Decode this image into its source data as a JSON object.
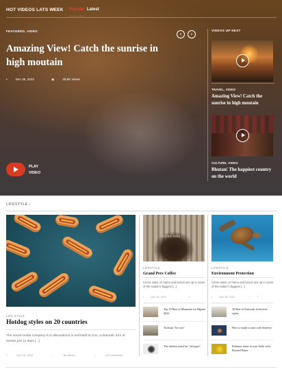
{
  "header": {
    "hot_label": "HOT VIDEOS LATS WEEK",
    "tabs": [
      {
        "label": "Popular",
        "active": true
      },
      {
        "label": "Latest",
        "active": false
      }
    ]
  },
  "hero": {
    "category": "FEATURED, VIDEO",
    "title": "Amazing View! Catch the sunrise in high moutain",
    "date": "Dec 26, 2022",
    "views": "28,6K Views",
    "play_label_1": "PLAY",
    "play_label_2": "VIDEO",
    "accent_color": "#d93a22"
  },
  "up_next": {
    "heading": "VIDEOS UP NEXT",
    "items": [
      {
        "category": "TRAVEL, VIDEO",
        "title": "Amazing View! Catch the sunrise in high moutain"
      },
      {
        "category": "CULTURE, VIDEO",
        "title": "Bhutan! The happiest country on the world"
      }
    ]
  },
  "lifestyle": {
    "section_label": "LIFESTYLE",
    "main": {
      "category": "LIFE STYLE",
      "title": "Hotdog styles on 20 countries",
      "desc": "The social media company is in discussions to sell itself to Con, a dramatic turn of events just 11 days [...]",
      "date": "Dec 16, 2022",
      "author": "By Admin",
      "comments": "20 Comments"
    },
    "col1": {
      "category": "LIFESTYLE",
      "title": "Grand Pers Coffee",
      "desc": "Crime rates on trains and buses are up in some of the nation's biggest [...]",
      "date": "Dec 16, 2022",
      "comments": "7",
      "related": [
        "Top 10 Best of Mustache for Hipster 2022",
        "Tucksuit \"lie ooo\"",
        "The fashion trend for \"old guys\""
      ]
    },
    "col2": {
      "category": "LIFESTYLE",
      "title": "Environment Protection",
      "desc": "Crime rates on trains and buses are up in some of the nation's biggest [...]",
      "date": "Dec 16, 2022",
      "comments": "7",
      "related": [
        "10 Best of Seafoods in Incoive styles",
        "How to make a toast with Seaferry",
        "Enhance water to your body with Boosed Water"
      ]
    }
  },
  "icons": {
    "calendar": "calendar-icon",
    "eye": "eye-icon",
    "comment": "comment-icon",
    "user": "user-icon",
    "play": "play-icon",
    "chevron": "chevron-right-icon"
  }
}
